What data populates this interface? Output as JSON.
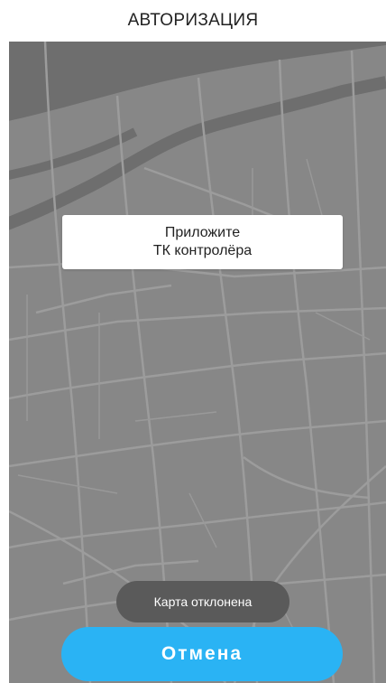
{
  "header": {
    "title": "АВТОРИЗАЦИЯ"
  },
  "map": {
    "background_color": "#878787",
    "road_color": "#9d9d9d",
    "river_color": "#6b6b6b"
  },
  "prompt": {
    "line1": "Приложите",
    "line2": "ТК контролёра"
  },
  "toast": {
    "text": "Карта отклонена"
  },
  "actions": {
    "cancel_label": "Отмена",
    "cancel_color": "#2ab3f4"
  }
}
